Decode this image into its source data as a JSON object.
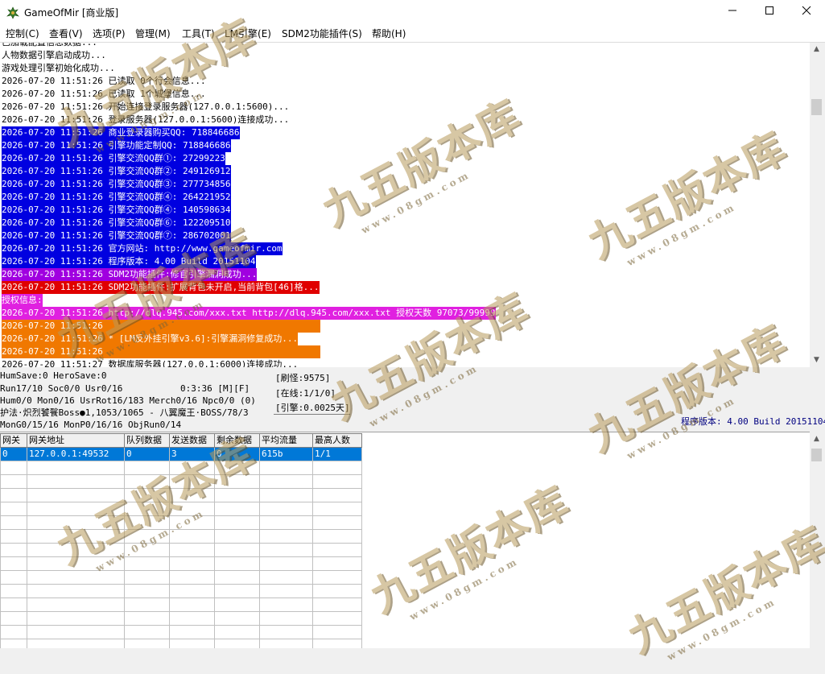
{
  "window": {
    "title": "GameOfMir [商业版]",
    "minimize": "—",
    "maximize": "☐",
    "close": "✕"
  },
  "menu": [
    "控制(C)",
    "查看(V)",
    "选项(P)",
    "管理(M)",
    "工具(T)",
    "LM引擎(E)",
    "SDM2功能插件(S)",
    "帮助(H)"
  ],
  "log": [
    {
      "text": "已加载配置信息数据...",
      "bg": "#ffffff",
      "fg": "#000000"
    },
    {
      "text": "人物数据引擎启动成功...",
      "bg": "#ffffff",
      "fg": "#000000"
    },
    {
      "text": "游戏处理引擎初始化成功...",
      "bg": "#ffffff",
      "fg": "#000000"
    },
    {
      "text": "2026-07-20 11:51:26 已读取 0个行会信息...",
      "bg": "#ffffff",
      "fg": "#000000"
    },
    {
      "text": "2026-07-20 11:51:26 已读取 1个城堡信息...",
      "bg": "#ffffff",
      "fg": "#000000"
    },
    {
      "text": "2026-07-20 11:51:26 开始连接登录服务器(127.0.0.1:5600)...",
      "bg": "#ffffff",
      "fg": "#000000"
    },
    {
      "text": "2026-07-20 11:51:26 登录服务器(127.0.0.1:5600)连接成功...",
      "bg": "#ffffff",
      "fg": "#000000"
    },
    {
      "text": "2026-07-20 11:51:26 商业登录器购买QQ: 718846686",
      "bg": "#0000e0",
      "fg": "#ffffff"
    },
    {
      "text": "2026-07-20 11:51:26 引擎功能定制QQ: 718846686",
      "bg": "#0000e0",
      "fg": "#ffffff"
    },
    {
      "text": "2026-07-20 11:51:26 引擎交流QQ群①: 27299223",
      "bg": "#0000e0",
      "fg": "#ffffff"
    },
    {
      "text": "2026-07-20 11:51:26 引擎交流QQ群②: 249126912",
      "bg": "#0000e0",
      "fg": "#ffffff"
    },
    {
      "text": "2026-07-20 11:51:26 引擎交流QQ群③: 277734856",
      "bg": "#0000e0",
      "fg": "#ffffff"
    },
    {
      "text": "2026-07-20 11:51:26 引擎交流QQ群④: 264221952",
      "bg": "#0000e0",
      "fg": "#ffffff"
    },
    {
      "text": "2026-07-20 11:51:26 引擎交流QQ群④: 140598634",
      "bg": "#0000e0",
      "fg": "#ffffff"
    },
    {
      "text": "2026-07-20 11:51:26 引擎交流QQ群⑥: 122209510",
      "bg": "#0000e0",
      "fg": "#ffffff"
    },
    {
      "text": "2026-07-20 11:51:26 引擎交流QQ群⑦: 286702001",
      "bg": "#0000e0",
      "fg": "#ffffff"
    },
    {
      "text": "2026-07-20 11:51:26 官方网站: http://www.gameofmir.com",
      "bg": "#0000e0",
      "fg": "#ffffff"
    },
    {
      "text": "2026-07-20 11:51:26 程序版本: 4.00 Build 20151104",
      "bg": "#0000e0",
      "fg": "#ffffff"
    },
    {
      "text": "2026-07-20 11:51:26 SDM2功能插件:修官引擎漏洞成功...",
      "bg": "#a000e0",
      "fg": "#ffffff"
    },
    {
      "text": "2026-07-20 11:51:26 SDM2功能插件:扩展背包未开启,当前背包[46]格...",
      "bg": "#e00000",
      "fg": "#ffffff"
    },
    {
      "text": "授权信息:",
      "bg": "#e020e0",
      "fg": "#ffffff"
    },
    {
      "text": "2026-07-20 11:51:26 http://dlq.945.com/xxx.txt http://dlq.945.com/xxx.txt 授权天数 97073/99999",
      "bg": "#e020e0",
      "fg": "#ffffff"
    },
    {
      "text": "2026-07-20 11:51:26",
      "bg": "#f07800",
      "fg": "#ffffff",
      "fill": true
    },
    {
      "text": "2026-07-20 11:51:26 * [LM反外挂引擎v3.6]:引擎漏洞修复成功...",
      "bg": "#f07800",
      "fg": "#ffffff"
    },
    {
      "text": "2026-07-20 11:51:26",
      "bg": "#f07800",
      "fg": "#ffffff",
      "fill": true
    },
    {
      "text": "2026-07-20 11:51:27 数据库服务器(127.0.0.1:6000)连接成功...",
      "bg": "#ffffff",
      "fg": "#000000"
    }
  ],
  "status": {
    "line1": "HumSave:0 HeroSave:0",
    "line2a": "Run17/10 Soc0/0 Usr0/16",
    "line2b": "0:3:36 [M][F]",
    "line3": "Hum0/0 Mon0/16 UsrRot16/183 Merch0/16 Npc0/0 (0)",
    "line4": "护法·炽烈饕餮Boss●1,1053/1065 - 八翼魔王·BOSS/78/3",
    "line5": "MonG0/15/16 MonP0/16/16 ObjRun0/14",
    "refresh": "[刷怪:9575]",
    "online": "[在线:1/1/0]",
    "engine": "[引擎:0.0025天]",
    "version": "程序版本: 4.00 Build 20151104"
  },
  "gateway_table": {
    "headers": [
      "网关",
      "网关地址",
      "队列数据",
      "发送数据",
      "剩余数据",
      "平均流量",
      "最高人数"
    ],
    "rows": [
      [
        "0",
        "127.0.0.1:49532",
        "0",
        "3",
        "0",
        "615b",
        "1/1"
      ]
    ]
  },
  "watermark": {
    "title": "九五版本库",
    "url": "www.08gm.com"
  },
  "colors": {
    "selection": "#0078d7",
    "version_text": "#000080"
  }
}
